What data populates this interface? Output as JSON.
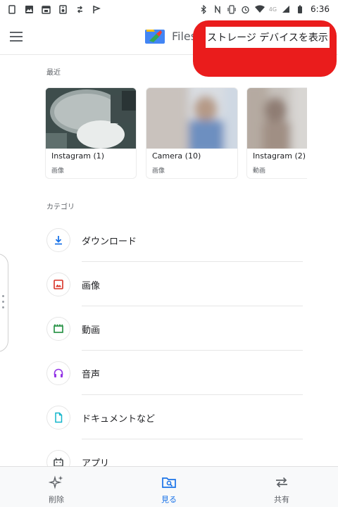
{
  "status_bar": {
    "time": "6:36",
    "network": "4G",
    "left_icons": [
      "tablet-icon",
      "image-icon",
      "calendar-icon",
      "speaker-icon",
      "sync-icon",
      "flag-icon"
    ],
    "right_icons": [
      "bluetooth-icon",
      "nfc-icon",
      "vibrate-icon",
      "alarm-icon",
      "wifi-icon",
      "signal-icon",
      "battery-icon"
    ]
  },
  "app_bar": {
    "title": "Files",
    "menu_icon": "menu-icon",
    "storage_button_label": "ストレージ デバイスを表示",
    "highlight_color": "#ea1c1c"
  },
  "recent": {
    "label": "最近",
    "items": [
      {
        "name": "Instagram (1)",
        "type": "画像"
      },
      {
        "name": "Camera (10)",
        "type": "画像"
      },
      {
        "name": "Instagram (2)",
        "type": "動画"
      }
    ]
  },
  "categories": {
    "label": "カテゴリ",
    "items": [
      {
        "label": "ダウンロード",
        "icon": "download-icon",
        "color": "#1a73e8"
      },
      {
        "label": "画像",
        "icon": "image-icon",
        "color": "#d93025"
      },
      {
        "label": "動画",
        "icon": "video-icon",
        "color": "#1e8e3e"
      },
      {
        "label": "音声",
        "icon": "headphones-icon",
        "color": "#9334e6"
      },
      {
        "label": "ドキュメントなど",
        "icon": "document-icon",
        "color": "#12b5cb"
      },
      {
        "label": "アプリ",
        "icon": "android-icon",
        "color": "#3c4043"
      }
    ]
  },
  "bottom_nav": {
    "items": [
      {
        "label": "削除",
        "icon": "sparkle-icon",
        "active": false
      },
      {
        "label": "見る",
        "icon": "browse-icon",
        "active": true
      },
      {
        "label": "共有",
        "icon": "swap-icon",
        "active": false
      }
    ],
    "active_color": "#1a73e8"
  }
}
